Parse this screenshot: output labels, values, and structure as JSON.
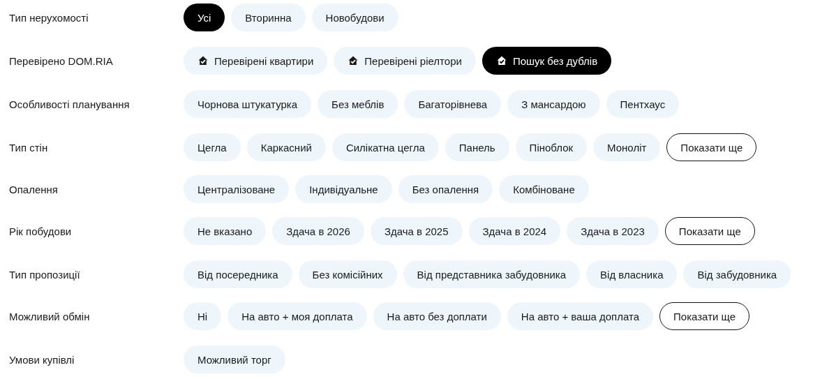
{
  "filters": [
    {
      "label": "Тип нерухомості",
      "options": [
        {
          "kind": "option",
          "label": "Усі",
          "selected": true
        },
        {
          "kind": "option",
          "label": "Вторинна",
          "selected": false
        },
        {
          "kind": "option",
          "label": "Новобудови",
          "selected": false
        }
      ]
    },
    {
      "label": "Перевірено DOM.RIA",
      "options": [
        {
          "kind": "verified",
          "label": "Перевірені квартири",
          "selected": false
        },
        {
          "kind": "verified",
          "label": "Перевірені ріелтори",
          "selected": false
        },
        {
          "kind": "verified",
          "label": "Пошук без дублів",
          "selected": true
        }
      ]
    },
    {
      "label": "Особливості планування",
      "options": [
        {
          "kind": "option",
          "label": "Чорнова штукатурка",
          "selected": false
        },
        {
          "kind": "option",
          "label": "Без меблів",
          "selected": false
        },
        {
          "kind": "option",
          "label": "Багаторівнева",
          "selected": false
        },
        {
          "kind": "option",
          "label": "З мансардою",
          "selected": false
        },
        {
          "kind": "option",
          "label": "Пентхаус",
          "selected": false
        }
      ]
    },
    {
      "label": "Тип стін",
      "options": [
        {
          "kind": "option",
          "label": "Цегла",
          "selected": false
        },
        {
          "kind": "option",
          "label": "Каркасний",
          "selected": false
        },
        {
          "kind": "option",
          "label": "Силікатна цегла",
          "selected": false
        },
        {
          "kind": "option",
          "label": "Панель",
          "selected": false
        },
        {
          "kind": "option",
          "label": "Піноблок",
          "selected": false
        },
        {
          "kind": "option",
          "label": "Моноліт",
          "selected": false
        },
        {
          "kind": "more",
          "label": "Показати ще"
        }
      ]
    },
    {
      "label": "Опалення",
      "options": [
        {
          "kind": "option",
          "label": "Централізоване",
          "selected": false
        },
        {
          "kind": "option",
          "label": "Індивідуальне",
          "selected": false
        },
        {
          "kind": "option",
          "label": "Без опалення",
          "selected": false
        },
        {
          "kind": "option",
          "label": "Комбіноване",
          "selected": false
        }
      ]
    },
    {
      "label": "Рік побудови",
      "options": [
        {
          "kind": "option",
          "label": "Не вказано",
          "selected": false
        },
        {
          "kind": "option",
          "label": "Здача в 2026",
          "selected": false
        },
        {
          "kind": "option",
          "label": "Здача в 2025",
          "selected": false
        },
        {
          "kind": "option",
          "label": "Здача в 2024",
          "selected": false
        },
        {
          "kind": "option",
          "label": "Здача в 2023",
          "selected": false
        },
        {
          "kind": "more",
          "label": "Показати ще"
        }
      ]
    },
    {
      "label": "Тип пропозиції",
      "options": [
        {
          "kind": "option",
          "label": "Від посередника",
          "selected": false
        },
        {
          "kind": "option",
          "label": "Без комісійних",
          "selected": false
        },
        {
          "kind": "option",
          "label": "Від представника забудовника",
          "selected": false
        },
        {
          "kind": "option",
          "label": "Від власника",
          "selected": false
        },
        {
          "kind": "option",
          "label": "Від забудовника",
          "selected": false
        }
      ]
    },
    {
      "label": "Можливий обмін",
      "options": [
        {
          "kind": "option",
          "label": "Ні",
          "selected": false
        },
        {
          "kind": "option",
          "label": "На авто + моя доплата",
          "selected": false
        },
        {
          "kind": "option",
          "label": "На авто без доплати",
          "selected": false
        },
        {
          "kind": "option",
          "label": "На авто + ваша доплата",
          "selected": false
        },
        {
          "kind": "more",
          "label": "Показати ще"
        }
      ]
    },
    {
      "label": "Умови купівлі",
      "options": [
        {
          "kind": "option",
          "label": "Можливий торг",
          "selected": false
        }
      ]
    }
  ]
}
